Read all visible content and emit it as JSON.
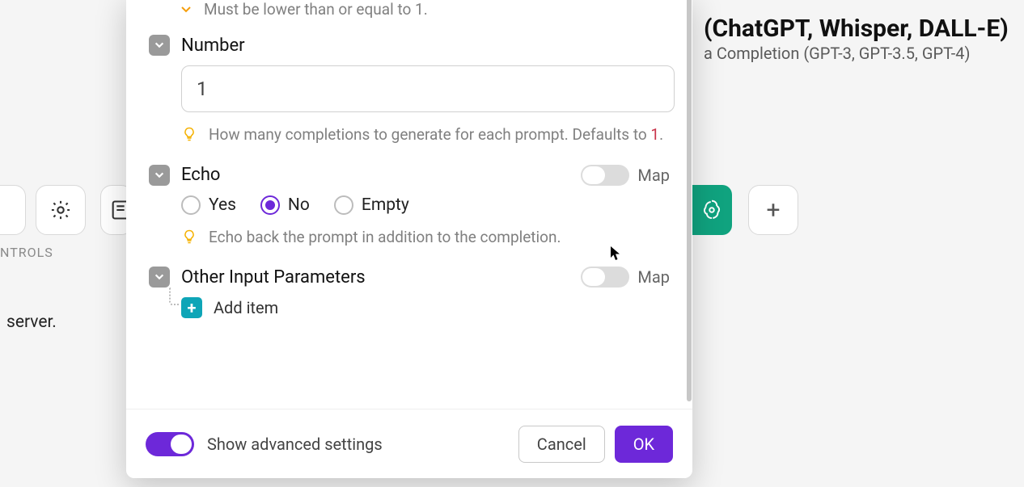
{
  "background": {
    "title_fragment": "(ChatGPT, Whisper, DALL-E)",
    "subtitle_fragment": "a Completion (GPT-3, GPT-3.5, GPT-4)",
    "controls_label": "NTROLS",
    "server_label": "server."
  },
  "modal": {
    "validation_hint": "Must be lower than or equal to 1.",
    "fields": {
      "number": {
        "label": "Number",
        "value": "1",
        "help_pre": "How many completions to generate for each prompt. Defaults to ",
        "help_code": "1",
        "help_post": "."
      },
      "echo": {
        "label": "Echo",
        "map_label": "Map",
        "options": {
          "yes": "Yes",
          "no": "No",
          "empty": "Empty"
        },
        "selected": "no",
        "help": "Echo back the prompt in addition to the completion."
      },
      "other": {
        "label": "Other Input Parameters",
        "map_label": "Map",
        "add_item": "Add item"
      }
    },
    "footer": {
      "advanced_label": "Show advanced settings",
      "cancel": "Cancel",
      "ok": "OK"
    }
  }
}
